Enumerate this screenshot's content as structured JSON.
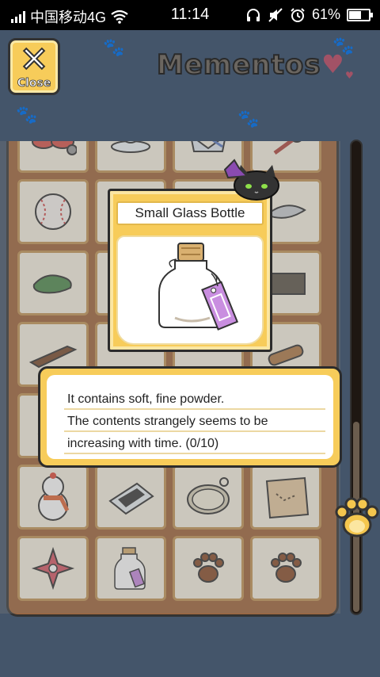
{
  "status_bar": {
    "carrier": "中国移动4G",
    "time": "11:14",
    "battery": "61%",
    "battery_level": 0.61
  },
  "header": {
    "close_label": "Close",
    "title": "Mementos",
    "heart_icon": "heart-icon"
  },
  "grid": {
    "icons": [
      "bow-icon",
      "teacup-icon",
      "clothing-icon",
      "key-icon",
      "baseball-icon",
      "blank",
      "blank",
      "fish-icon",
      "stone-icon",
      "blank",
      "blank",
      "map-scrap-icon",
      "wood-piece-icon",
      "blank",
      "blank",
      "rolling-pin-icon",
      "item-icon",
      "blank",
      "blank",
      "blank",
      "snowman-icon",
      "photo-frame-icon",
      "pocket-watch-icon",
      "treasure-map-icon",
      "shuriken-icon",
      "glass-bottle-icon",
      "paw-icon",
      "paw-icon"
    ]
  },
  "popup": {
    "item_name": "Small Glass Bottle",
    "item_icon": "glass-bottle-icon"
  },
  "description": {
    "line1": "It contains soft, fine powder.",
    "line2": "The contents strangely seems to be",
    "line3": "increasing with time. (0/10)"
  },
  "colors": {
    "background": "#44556a",
    "frame_gold": "#f7cc5a",
    "shelf_wood": "#a0653a",
    "title_text": "#6b6660",
    "heart": "#a25266"
  }
}
